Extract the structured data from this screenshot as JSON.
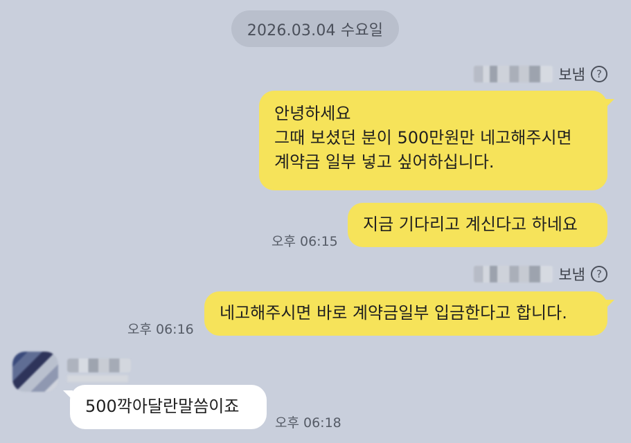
{
  "date_separator": {
    "text": "2026.03.04 수요일"
  },
  "messages": [
    {
      "sent_label": "보냄",
      "help_symbol": "?",
      "lines": [
        "안녕하세요",
        "그때 보셨던 분이 500만원만 네고해주시면",
        "계약금 일부 넣고 싶어하십니다."
      ]
    },
    {
      "text": "지금 기다리고 계신다고 하네요",
      "time": "오후 06:15"
    },
    {
      "sent_label": "보냄",
      "help_symbol": "?",
      "text": "네고해주시면 바로 계약금일부 입금한다고 합니다.",
      "time": "오후 06:16"
    },
    {
      "text": "500깍아달란말씀이죠",
      "time": "오후 06:18"
    }
  ]
}
